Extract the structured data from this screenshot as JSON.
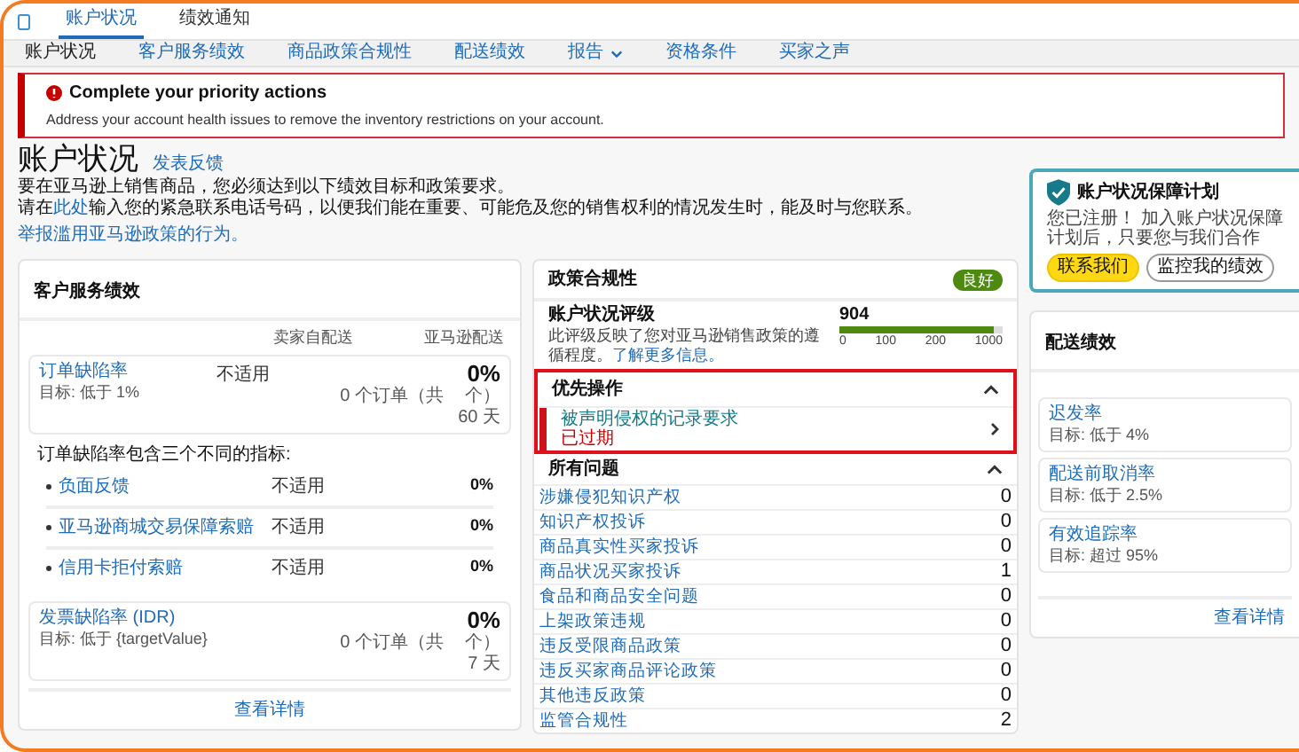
{
  "top_tabs": [
    {
      "label": "账户状况",
      "selected": true
    },
    {
      "label": "绩效通知",
      "selected": false
    }
  ],
  "nav": [
    {
      "label": "账户状况",
      "selected": true,
      "has_menu": false
    },
    {
      "label": "客户服务绩效",
      "selected": false,
      "has_menu": false
    },
    {
      "label": "商品政策合规性",
      "selected": false,
      "has_menu": false
    },
    {
      "label": "配送绩效",
      "selected": false,
      "has_menu": false
    },
    {
      "label": "报告",
      "selected": false,
      "has_menu": true
    },
    {
      "label": "资格条件",
      "selected": false,
      "has_menu": false
    },
    {
      "label": "买家之声",
      "selected": false,
      "has_menu": false
    }
  ],
  "alert": {
    "title": "Complete your priority actions",
    "message": "Address your account health issues to remove the inventory restrictions on your account."
  },
  "header": {
    "title": "账户状况",
    "feedback_link": "发表反馈",
    "line_1": "要在亚马逊上销售商品，您必须达到以下绩效目标和政策要求。",
    "line_2": {
      "before": "请在",
      "link": "此处",
      "after": "输入您的紧急联系电话号码，以便我们能在重要、可能危及您的销售权利的情况发生时，能及时与您联系。"
    },
    "report_link": "举报滥用亚马逊政策的行为。"
  },
  "protection": {
    "title": "账户状况保障计划",
    "text": "您已注册！ 加入账户状况保障计划后，只要您与我们合作",
    "buttons": [
      {
        "label": "联系我们",
        "kind": "primary"
      },
      {
        "label": "监控我的绩效",
        "kind": "secondary"
      }
    ]
  },
  "customer_service": {
    "title": "客户服务绩效",
    "columns": [
      "卖家自配送",
      "亚马逊配送"
    ],
    "odr": {
      "name": "订单缺陷率",
      "target": "目标: 低于 1%",
      "merchant": "不适用",
      "value": "0%",
      "orders": "0 个订单（共",
      "total": "个）",
      "period": "60 天"
    },
    "intro": "订单缺陷率包含三个不同的指标:",
    "metrics": [
      {
        "name": "负面反馈",
        "merchant": "不适用",
        "value": "0%"
      },
      {
        "name": "亚马逊商城交易保障索赔",
        "merchant": "不适用",
        "value": "0%"
      },
      {
        "name": "信用卡拒付索赔",
        "merchant": "不适用",
        "value": "0%"
      }
    ],
    "idr": {
      "name": "发票缺陷率 (IDR)",
      "target": "目标: 低于 {targetValue}",
      "value": "0%",
      "orders": "0 个订单（共",
      "total": "个）",
      "period": "7 天"
    },
    "details_link": "查看详情"
  },
  "policy": {
    "title": "政策合规性",
    "badge": "良好",
    "rating": {
      "title": "账户状况评级",
      "text": "此评级反映了您对亚马逊销售政策的遵循程度。",
      "link": "了解更多信息。",
      "score": "904",
      "level": 0.95,
      "ticks": [
        "0",
        "100",
        "200",
        "1000"
      ]
    },
    "priority": {
      "title": "优先操作",
      "expanded": true,
      "items": [
        {
          "name": "被声明侵权的记录要求",
          "status": "已过期"
        }
      ]
    },
    "issues": {
      "title": "所有问题",
      "expanded": true,
      "items": [
        {
          "name": "涉嫌侵犯知识产权",
          "count": "0"
        },
        {
          "name": "知识产权投诉",
          "count": "0"
        },
        {
          "name": "商品真实性买家投诉",
          "count": "0"
        },
        {
          "name": "商品状况买家投诉",
          "count": "1"
        },
        {
          "name": "食品和商品安全问题",
          "count": "0"
        },
        {
          "name": "上架政策违规",
          "count": "0"
        },
        {
          "name": "违反受限商品政策",
          "count": "0"
        },
        {
          "name": "违反买家商品评论政策",
          "count": "0"
        },
        {
          "name": "其他违反政策",
          "count": "0"
        },
        {
          "name": "监管合规性",
          "count": "2"
        }
      ]
    }
  },
  "delivery": {
    "title": "配送绩效",
    "metrics": [
      {
        "name": "迟发率",
        "target": "目标: 低于 4%"
      },
      {
        "name": "配送前取消率",
        "target": "目标: 低于 2.5%"
      },
      {
        "name": "有效追踪率",
        "target": "目标: 超过 95%"
      }
    ],
    "details_link": "查看详情"
  }
}
